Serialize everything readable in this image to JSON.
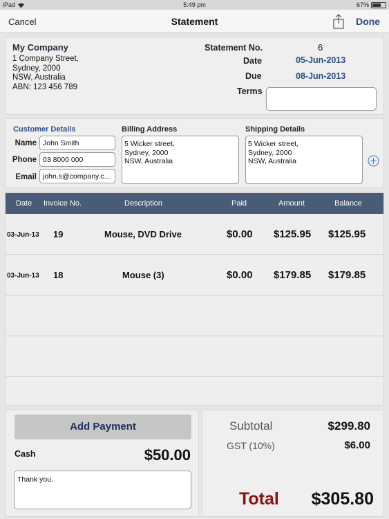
{
  "status_bar": {
    "device": "iPad",
    "time": "5:49 pm",
    "battery": "67%",
    "battery_level": 0.67
  },
  "nav": {
    "cancel": "Cancel",
    "title": "Statement",
    "done": "Done",
    "share_icon": "share-icon"
  },
  "company": {
    "name": "My Company",
    "address_lines": [
      "1 Company Street,",
      "Sydney, 2000",
      "NSW, Australia",
      "ABN: 123 456 789"
    ]
  },
  "statement": {
    "no_label": "Statement No.",
    "no": "6",
    "date_label": "Date",
    "date": "05-Jun-2013",
    "due_label": "Due",
    "due": "08-Jun-2013",
    "terms_label": "Terms",
    "terms": ""
  },
  "customer": {
    "heading": "Customer Details",
    "name_label": "Name",
    "name": "John Smith",
    "phone_label": "Phone",
    "phone": "03 8000 000",
    "email_label": "Email",
    "email": "john.s@company.c..."
  },
  "billing": {
    "heading": "Billing Address",
    "lines": [
      "5 Wicker street,",
      "Sydney, 2000",
      "NSW, Australia"
    ]
  },
  "shipping": {
    "heading": "Shipping Details",
    "lines": [
      "5 Wicker street,",
      "Sydney, 2000",
      "NSW, Australia"
    ]
  },
  "table": {
    "headers": [
      "Date",
      "Invoice No.",
      "Description",
      "Paid",
      "Amount",
      "Balance"
    ],
    "rows": [
      {
        "date": "03-Jun-13",
        "invoice": "19",
        "description": "Mouse, DVD Drive",
        "paid": "$0.00",
        "amount": "$125.95",
        "balance": "$125.95"
      },
      {
        "date": "03-Jun-13",
        "invoice": "18",
        "description": "Mouse (3)",
        "paid": "$0.00",
        "amount": "$179.85",
        "balance": "$179.85"
      }
    ]
  },
  "payment": {
    "add_label": "Add Payment",
    "method": "Cash",
    "amount": "$50.00",
    "note": "Thank you."
  },
  "totals": {
    "subtotal_label": "Subtotal",
    "subtotal": "$299.80",
    "gst_label": "GST (10%)",
    "gst": "$6.00",
    "total_label": "Total",
    "total": "$305.80"
  },
  "colors": {
    "header_bg": "#495b77",
    "accent_blue": "#2a4c86",
    "total_red": "#8b1010"
  }
}
